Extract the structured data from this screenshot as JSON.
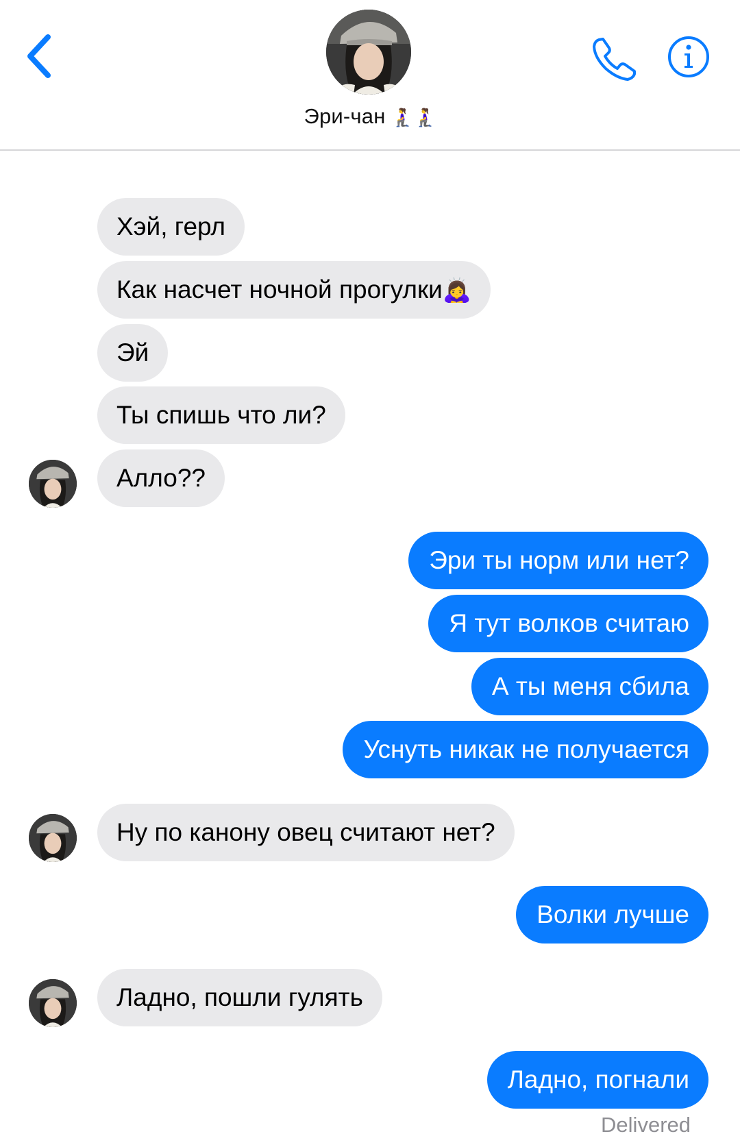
{
  "header": {
    "contact_name": "Эри-чан",
    "name_emoji": "🧎‍♀️🧎‍♀️"
  },
  "colors": {
    "accent": "#0a7cff",
    "incoming_bubble": "#e9e9eb",
    "divider": "#d6d6d8",
    "status_text": "#8e8e93"
  },
  "icons": {
    "back": "chevron-left-icon",
    "call": "phone-icon",
    "info": "info-icon"
  },
  "messages": [
    {
      "dir": "in",
      "text": "Хэй, герл"
    },
    {
      "dir": "in",
      "text": "Как насчет ночной прогулки",
      "emoji": "🙇‍♀️"
    },
    {
      "dir": "in",
      "text": "Эй"
    },
    {
      "dir": "in",
      "text": "Ты спишь что ли?"
    },
    {
      "dir": "in",
      "text": "Алло??"
    },
    {
      "dir": "out",
      "text": "Эри ты норм или нет?"
    },
    {
      "dir": "out",
      "text": "Я тут волков считаю"
    },
    {
      "dir": "out",
      "text": "А ты меня сбила"
    },
    {
      "dir": "out",
      "text": "Уснуть никак не получается"
    },
    {
      "dir": "in",
      "text": "Ну по канону овец считают нет?"
    },
    {
      "dir": "out",
      "text": "Волки лучше"
    },
    {
      "dir": "in",
      "text": "Ладно, пошли гулять"
    },
    {
      "dir": "out",
      "text": "Ладно, погнали"
    }
  ],
  "status": "Delivered"
}
